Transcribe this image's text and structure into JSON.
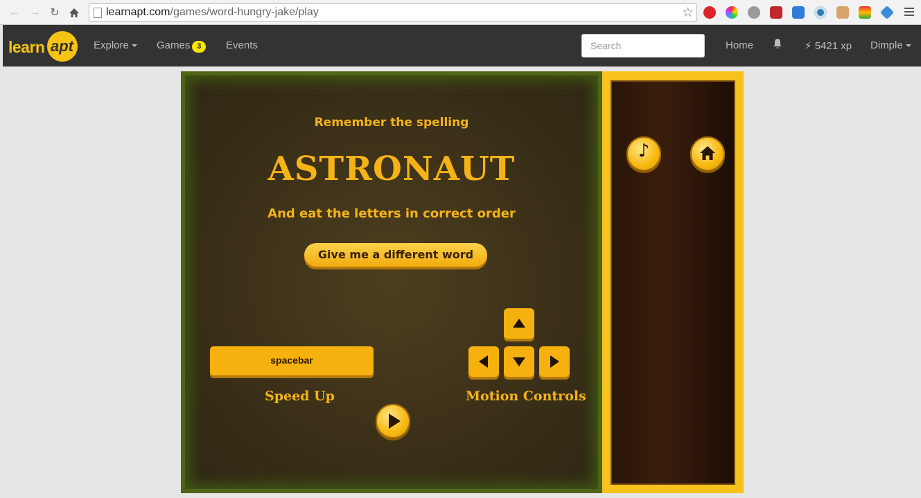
{
  "browser": {
    "url_domain": "learnapt.com",
    "url_path": "/games/word-hungry-jake/play"
  },
  "header": {
    "logo_text": "learn",
    "logo_badge": "apt",
    "nav": [
      {
        "label": "Explore"
      },
      {
        "label": "Games",
        "badge": "3"
      },
      {
        "label": "Events"
      }
    ],
    "search_placeholder": "Search",
    "home": "Home",
    "xp": "5421 xp",
    "user": "Dimple"
  },
  "game": {
    "prompt": "Remember the spelling",
    "word": "ASTRONAUT",
    "instruction": "And eat the letters in correct order",
    "different_word_button": "Give me a different word",
    "speed_key": "spacebar",
    "speed_label": "Speed Up",
    "motion_label": "Motion Controls"
  },
  "colors": {
    "accent": "#f5b318",
    "header_bg": "#333333",
    "board_border": "#4f6416"
  }
}
